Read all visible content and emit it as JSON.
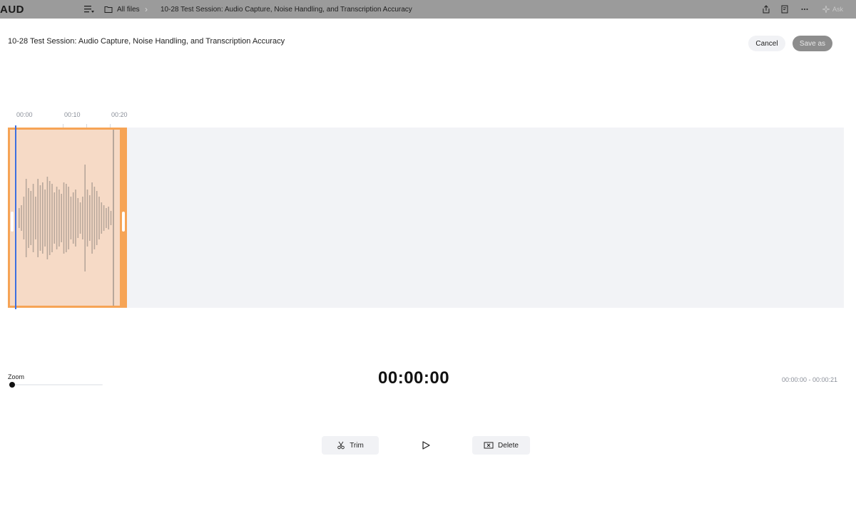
{
  "topbar": {
    "brand": "AUD",
    "breadcrumb_root": "All files",
    "breadcrumb_separator": "›",
    "breadcrumb_file": "10-28 Test Session: Audio Capture, Noise Handling, and Transcription Accuracy",
    "ask_label": "Ask"
  },
  "header": {
    "title": "10-28 Test Session: Audio Capture, Noise Handling, and Transcription Accuracy",
    "cancel_label": "Cancel",
    "save_label": "Save as"
  },
  "ruler": {
    "ticks": [
      "00:00",
      "00:10",
      "00:20"
    ]
  },
  "editor": {
    "current_time": "00:00:00",
    "selection_range": "00:00:00 - 00:00:21",
    "zoom_label": "Zoom",
    "zoom_level": 0
  },
  "actions": {
    "trim_label": "Trim",
    "delete_label": "Delete"
  },
  "colors": {
    "selection_fill": "#f6dac6",
    "selection_border": "#f6a456",
    "playhead": "#3d6fe0",
    "track_bg": "#f2f3f6",
    "waveform": "#b7a79b"
  },
  "icons": {
    "menu": "menu-toggle-icon",
    "folder": "folder-icon",
    "share": "share-icon",
    "bookmark": "bookmark-icon",
    "more": "more-icon",
    "sparkle": "sparkle-icon",
    "trim": "scissors-icon",
    "play": "play-icon",
    "delete": "delete-box-icon"
  }
}
